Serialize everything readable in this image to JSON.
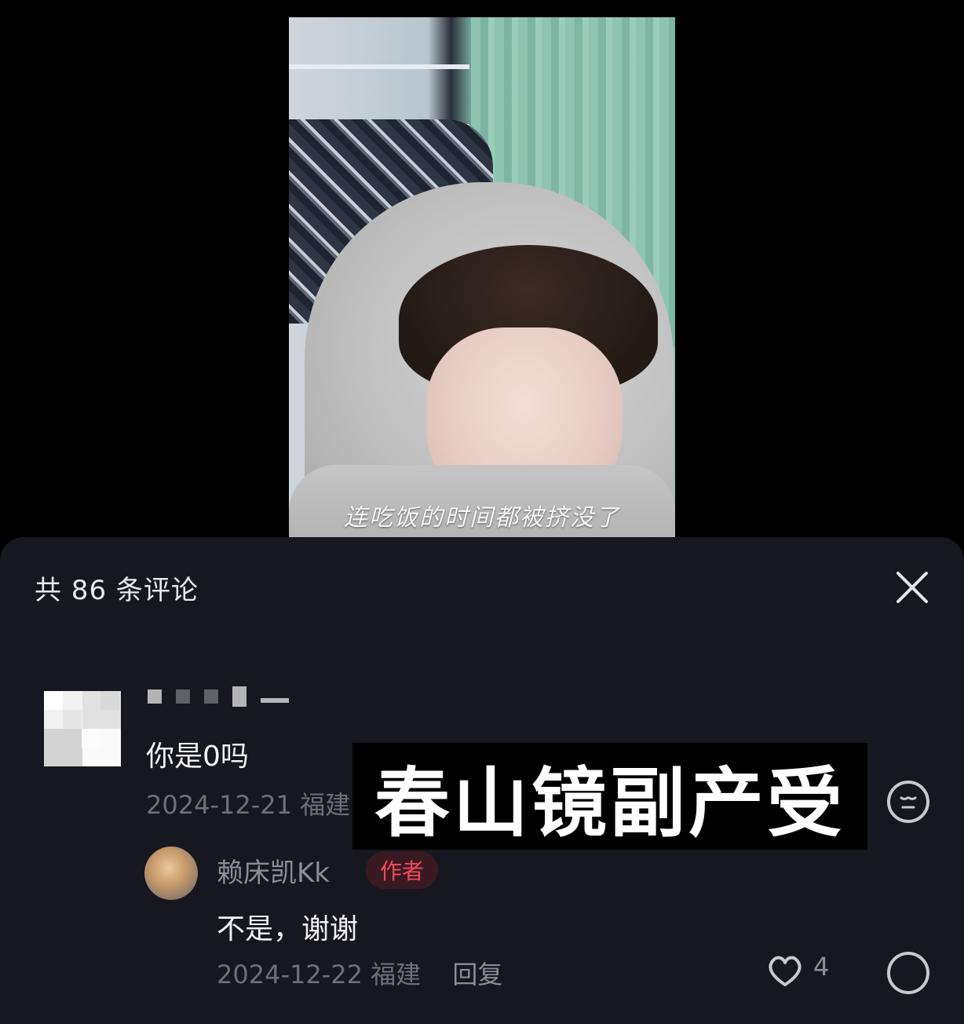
{
  "video": {
    "caption": "连吃饭的时间都被挤没了"
  },
  "comments_panel": {
    "title": "共 86 条评论",
    "close_icon": "close-icon"
  },
  "comment": {
    "text": "你是0吗",
    "date": "2024-12-21",
    "location_partial": "福建"
  },
  "overlay": {
    "text": "春山镜副产受"
  },
  "reply": {
    "author": "赖床凯Kk",
    "badge": "作者",
    "text": "不是，谢谢",
    "date": "2024-12-22",
    "location": "福建",
    "reply_label": "回复",
    "like_count_partial": "4"
  },
  "colors": {
    "sheet_bg": "#17171f",
    "badge_text": "#f04a5c",
    "meta_text": "#6f6f78"
  }
}
